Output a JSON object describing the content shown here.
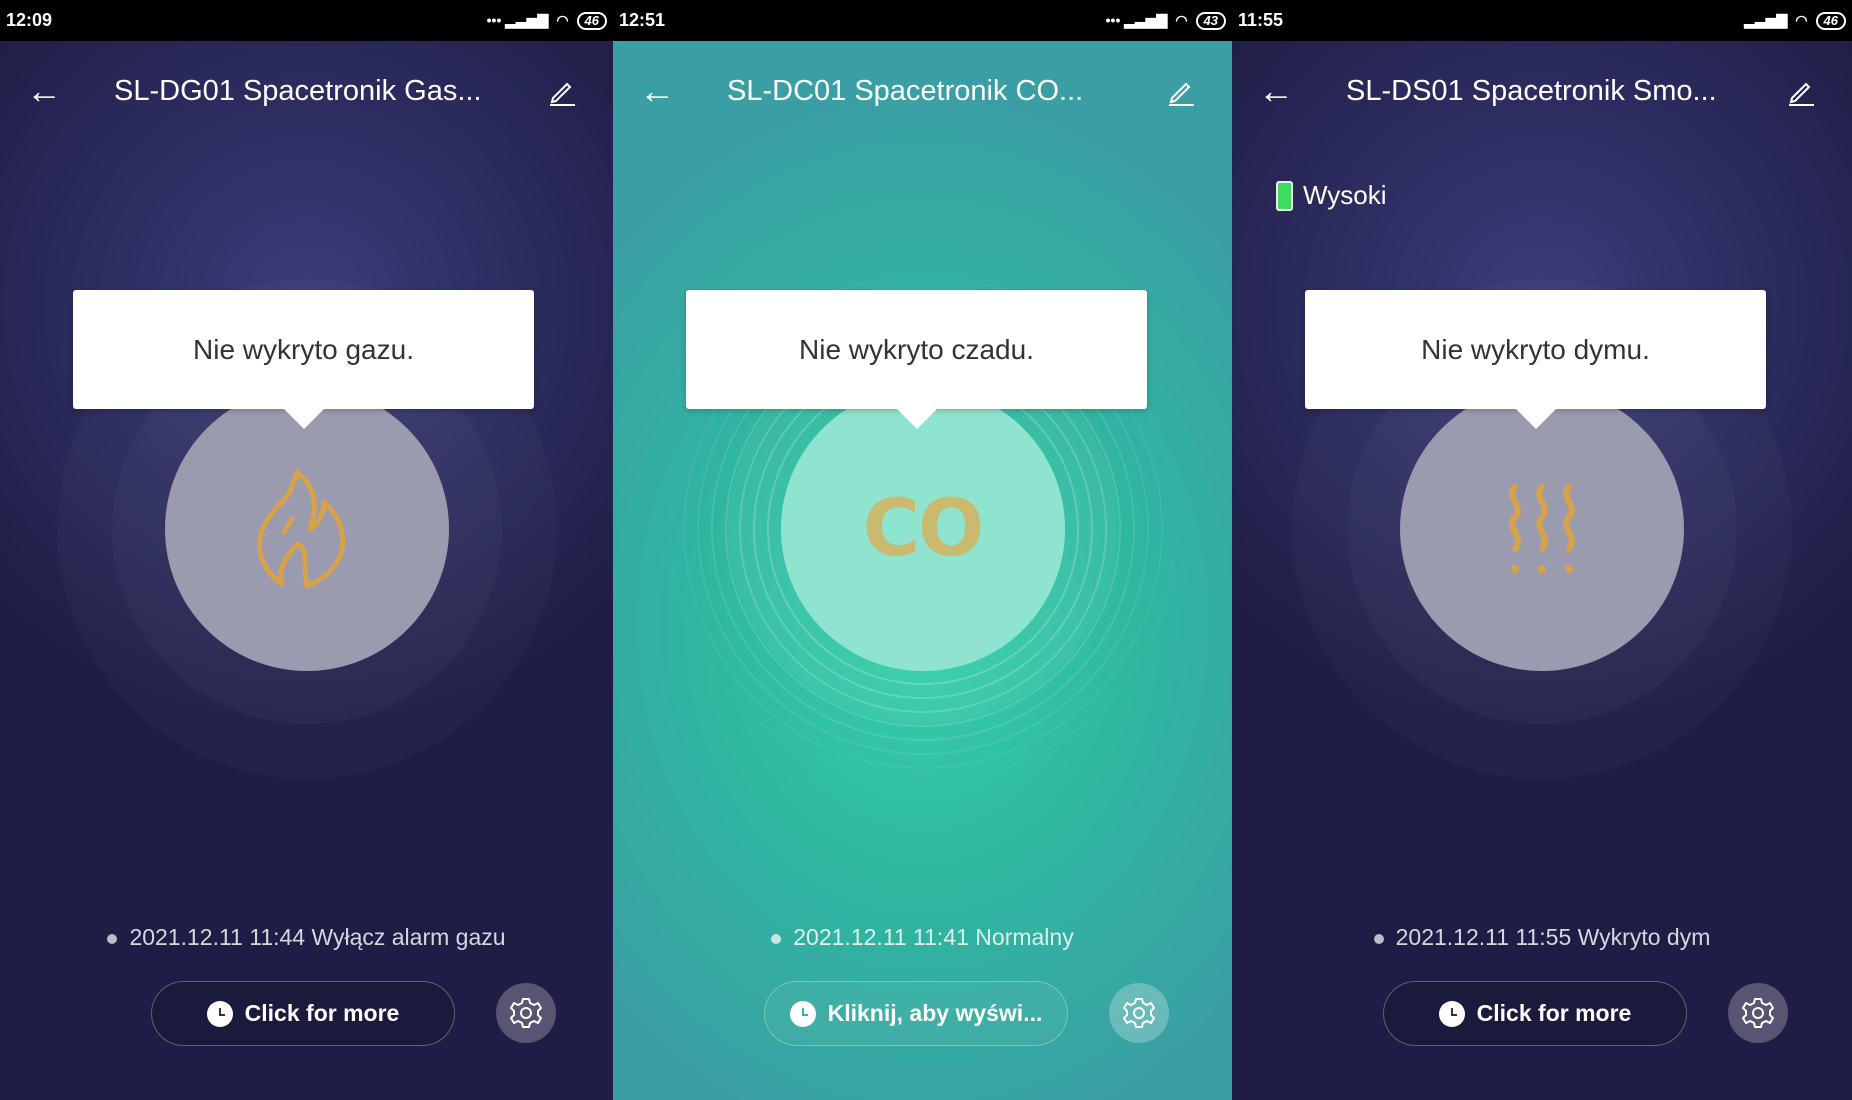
{
  "colors": {
    "accent_icon": "#d8a24a",
    "battery_green": "#3ddc61",
    "teal_bg": "#2fb7a0",
    "dark_bg": "#2c2c60"
  },
  "panels": [
    {
      "status": {
        "time": "12:09",
        "battery": "46"
      },
      "title": "SL-DG01 Spacetronik Gas...",
      "message": "Nie wykryto gazu.",
      "icon": "flame-icon",
      "event": "2021.12.11 11:44 Wyłącz alarm gazu",
      "button": "Click for more"
    },
    {
      "status": {
        "time": "12:51",
        "battery": "43"
      },
      "title": "SL-DC01 Spacetronik CO...",
      "message": "Nie wykryto czadu.",
      "icon_text": "CO",
      "event": "2021.12.11 11:41 Normalny",
      "button": "Kliknij, aby wyświ..."
    },
    {
      "status": {
        "time": "11:55",
        "battery": "46"
      },
      "title": "SL-DS01 Spacetronik Smo...",
      "battery_level": "Wysoki",
      "message": "Nie wykryto dymu.",
      "icon": "smoke-icon",
      "event": "2021.12.11 11:55 Wykryto dym",
      "button": "Click for more"
    }
  ]
}
